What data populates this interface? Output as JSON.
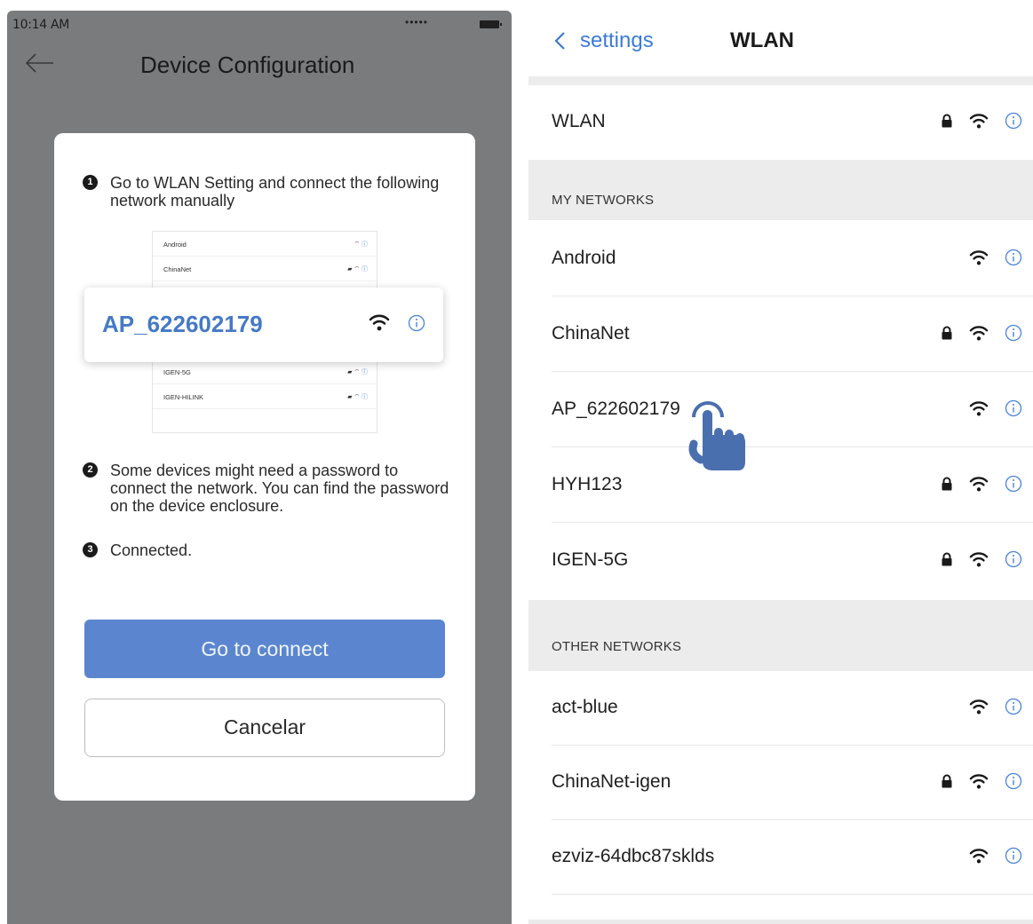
{
  "left": {
    "status_time": "10:14 AM",
    "status_signal": "•••••",
    "title": "Device Configuration",
    "steps": [
      {
        "num": "1",
        "text": "Go to WLAN Setting and connect the following network manually"
      },
      {
        "num": "2",
        "text": "Some devices might need a password to connect the network. You can find the password on the device enclosure."
      },
      {
        "num": "3",
        "text": "Connected."
      }
    ],
    "mini_networks": [
      {
        "name": "Android",
        "lock": false
      },
      {
        "name": "ChinaNet",
        "lock": true
      },
      {
        "name": "IGEN-5G",
        "lock": true
      },
      {
        "name": "IGEN-HILINK",
        "lock": true
      }
    ],
    "highlight_ssid": "AP_622602179",
    "primary_button": "Go to connect",
    "secondary_button": "Cancelar"
  },
  "right": {
    "back_label": "settings",
    "title": "WLAN",
    "wlan_row": {
      "name": "WLAN",
      "lock": true
    },
    "my_networks_label": "MY NETWORKS",
    "my_networks": [
      {
        "name": "Android",
        "lock": false
      },
      {
        "name": "ChinaNet",
        "lock": true
      },
      {
        "name": "AP_622602179",
        "lock": false
      },
      {
        "name": "HYH123",
        "lock": true
      },
      {
        "name": "IGEN-5G",
        "lock": true
      }
    ],
    "other_networks_label": "OTHER  NETWORKS",
    "other_networks": [
      {
        "name": "act-blue",
        "lock": false
      },
      {
        "name": "ChinaNet-igen",
        "lock": true
      },
      {
        "name": "ezviz-64dbc87sklds",
        "lock": false
      }
    ]
  },
  "colors": {
    "accent": "#5b86cf",
    "link": "#3d7bd6",
    "overlay": "#7a7b7c"
  }
}
